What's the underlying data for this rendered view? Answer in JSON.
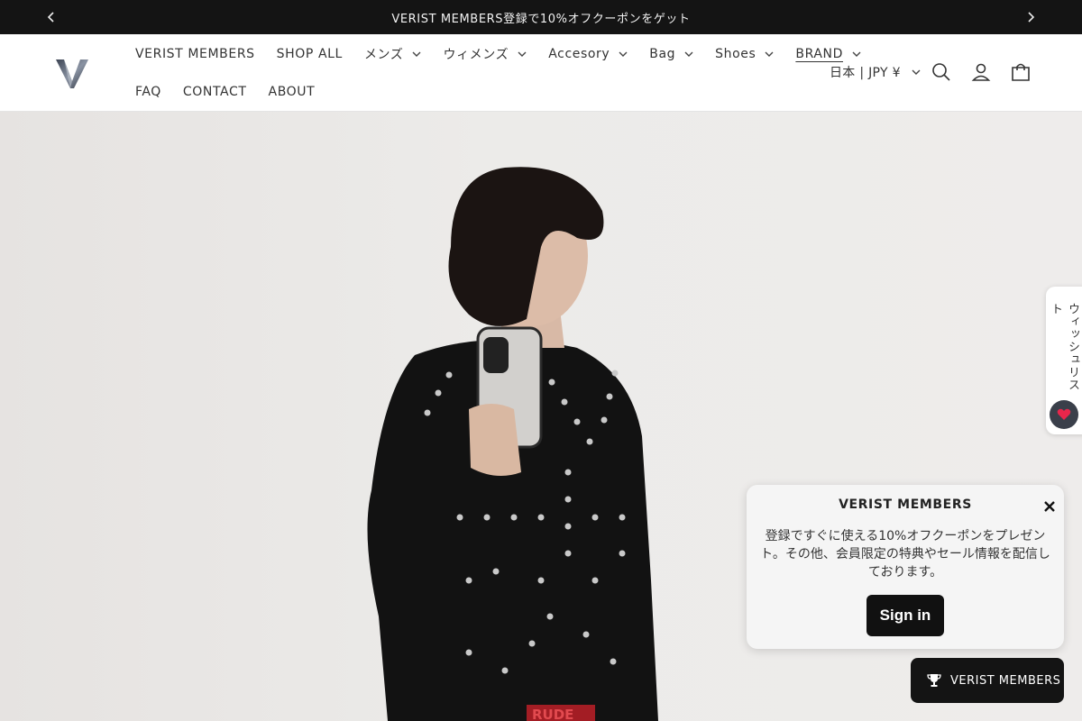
{
  "announcement": {
    "text": "VERIST MEMBERS登録で10%オフクーポンをゲット",
    "prev_icon": "chevron-left-icon",
    "next_icon": "chevron-right-icon"
  },
  "header": {
    "logo_icon": "verist-v-logo",
    "nav_row1": [
      {
        "label": "VERIST MEMBERS",
        "dropdown": false
      },
      {
        "label": "SHOP ALL",
        "dropdown": false
      },
      {
        "label": "メンズ",
        "dropdown": true
      },
      {
        "label": "ウィメンズ",
        "dropdown": true
      },
      {
        "label": "Accesory",
        "dropdown": true
      },
      {
        "label": "Bag",
        "dropdown": true
      },
      {
        "label": "Shoes",
        "dropdown": true
      },
      {
        "label": "BRAND",
        "dropdown": true,
        "active": true
      }
    ],
    "nav_row2": [
      {
        "label": "FAQ"
      },
      {
        "label": "CONTACT"
      },
      {
        "label": "ABOUT"
      }
    ],
    "locale": "日本 | JPY ¥",
    "icons": [
      "search-icon",
      "account-icon",
      "cart-icon"
    ]
  },
  "hero": {
    "phone_case_print": "",
    "waistband_text": "RUDE"
  },
  "wishlist_tab": {
    "label": "ウィッシュリスト",
    "icon": "heart-icon"
  },
  "popup": {
    "title": "VERIST MEMBERS",
    "body": "登録ですぐに使える10%オフクーポンをプレゼント。その他、会員限定の特典やセール情報を配信しております。",
    "button_label": "Sign in",
    "close_icon": "close-icon"
  },
  "rewards_button": {
    "label": "VERIST MEMBERS",
    "icon": "trophy-icon"
  },
  "colors": {
    "announcement_bg": "#141414",
    "header_bg": "#ffffff",
    "popup_bg": "#f5f5f5",
    "button_bg": "#111111",
    "heart_bg": "#3a3f4a",
    "heart": "#e8264b"
  }
}
